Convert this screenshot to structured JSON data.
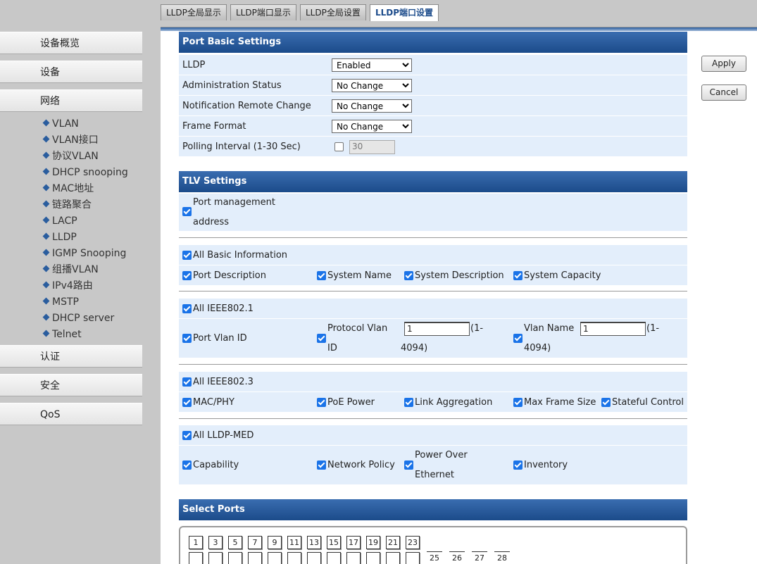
{
  "tabs": [
    "LLDP全局显示",
    "LLDP端口显示",
    "LLDP全局设置",
    "LLDP端口设置"
  ],
  "menu": {
    "top": [
      "设备概览",
      "设备",
      "网络"
    ],
    "network_items": [
      "VLAN",
      "VLAN接口",
      "协议VLAN",
      "DHCP snooping",
      "MAC地址",
      "链路聚合",
      "LACP",
      "LLDP",
      "IGMP Snooping",
      "组播VLAN",
      "IPv4路由",
      "MSTP",
      "DHCP server",
      "Telnet"
    ],
    "bottom": [
      "认证",
      "安全",
      "QoS"
    ]
  },
  "basic": {
    "title": "Port Basic Settings",
    "lldp_label": "LLDP",
    "lldp_value": "Enabled",
    "admin_label": "Administration Status",
    "admin_value": "No Change",
    "notify_label": "Notification Remote Change",
    "notify_value": "No Change",
    "frame_label": "Frame Format",
    "frame_value": "No Change",
    "poll_label": "Polling Interval (1-30 Sec)",
    "poll_value": "30"
  },
  "tlv": {
    "title": "TLV Settings",
    "port_mgmt_1": "Port management",
    "port_mgmt_2": "address",
    "all_basic": "All Basic Information",
    "port_desc": "Port Description",
    "sys_name": "System Name",
    "sys_desc": "System Description",
    "sys_cap": "System Capacity",
    "all_8021": "All IEEE802.1",
    "port_vlan": "Port Vlan ID",
    "proto_vlan_1": "Protocol Vlan",
    "proto_vlan_2": "ID",
    "proto_value": "1",
    "range_1": "(1-",
    "range_2": "4094)",
    "vlan_name": "Vlan Name",
    "vlan_value": "1",
    "all_8023": "All IEEE802.3",
    "mac_phy": "MAC/PHY",
    "poe": "PoE Power",
    "link_agg": "Link Aggregation",
    "max_frame": "Max Frame Size",
    "stateful": "Stateful Control",
    "all_med": "All LLDP-MED",
    "capability": "Capability",
    "net_policy": "Network Policy",
    "poe_1": "Power Over",
    "poe_2": "Ethernet",
    "inventory": "Inventory"
  },
  "ports": {
    "title": "Select Ports",
    "row1": [
      "1",
      "3",
      "5",
      "7",
      "9",
      "11",
      "13",
      "15",
      "17",
      "19",
      "21",
      "23"
    ],
    "row2_extra": [
      "25",
      "26",
      "27",
      "28"
    ]
  },
  "buttons": {
    "apply": "Apply",
    "cancel": "Cancel"
  }
}
